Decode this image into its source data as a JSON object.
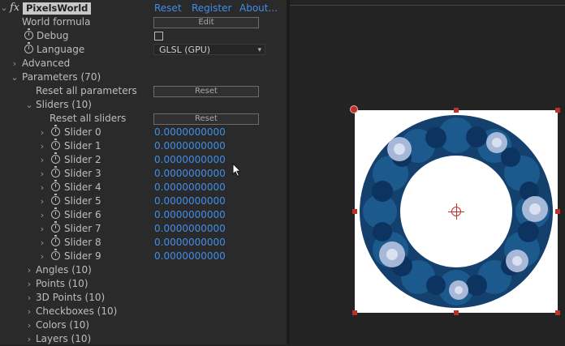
{
  "header": {
    "fx_label": "fx",
    "plugin_name": "PixelsWorld",
    "links": [
      "Reset",
      "Register",
      "About..."
    ]
  },
  "params": {
    "world_formula": {
      "label": "World formula",
      "button": "Edit"
    },
    "debug": {
      "label": "Debug",
      "checked": false
    },
    "language": {
      "label": "Language",
      "value": "GLSL (GPU)"
    },
    "advanced": {
      "label": "Advanced"
    },
    "parameters": {
      "label": "Parameters (70)"
    },
    "reset_all_parameters": {
      "label": "Reset all parameters",
      "button": "Reset"
    },
    "sliders": {
      "label": "Sliders (10)"
    },
    "reset_all_sliders": {
      "label": "Reset all sliders",
      "button": "Reset"
    },
    "slider_list": [
      {
        "label": "Slider 0",
        "value": "0.0000000000"
      },
      {
        "label": "Slider 1",
        "value": "0.0000000000"
      },
      {
        "label": "Slider 2",
        "value": "0.0000000000"
      },
      {
        "label": "Slider 3",
        "value": "0.0000000000"
      },
      {
        "label": "Slider 4",
        "value": "0.0000000000"
      },
      {
        "label": "Slider 5",
        "value": "0.0000000000"
      },
      {
        "label": "Slider 6",
        "value": "0.0000000000"
      },
      {
        "label": "Slider 7",
        "value": "0.0000000000"
      },
      {
        "label": "Slider 8",
        "value": "0.0000000000"
      },
      {
        "label": "Slider 9",
        "value": "0.0000000000"
      }
    ],
    "groups": [
      "Angles (10)",
      "Points (10)",
      "3D Points (10)",
      "Checkboxes (10)",
      "Colors (10)",
      "Layers (10)"
    ]
  },
  "colors": {
    "value_blue": "#3f8ee8",
    "handle_red": "#c0302a",
    "flower_dark": "#14406e",
    "flower_light": "#b3c1df"
  },
  "icons": {
    "expand": "chevron-right-icon",
    "collapse": "chevron-down-icon",
    "stopwatch": "stopwatch-icon"
  }
}
